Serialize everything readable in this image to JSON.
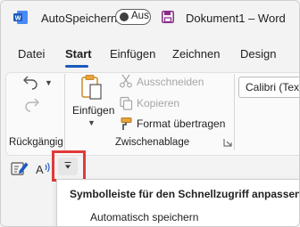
{
  "titlebar": {
    "autosave_label": "AutoSpeichern",
    "autosave_state": "Aus",
    "document_title": "Dokument1 – Word"
  },
  "tabs": [
    {
      "label": "Datei"
    },
    {
      "label": "Start"
    },
    {
      "label": "Einfügen"
    },
    {
      "label": "Zeichnen"
    },
    {
      "label": "Design"
    }
  ],
  "active_tab": "Start",
  "ribbon": {
    "undo_group_label": "Rückgängig",
    "paste_label": "Einfügen",
    "clipboard_group_label": "Zwischenablage",
    "cut_label": "Ausschneiden",
    "copy_label": "Kopieren",
    "format_painter_label": "Format übertragen",
    "font_name": "Calibri (Text)"
  },
  "menu": {
    "header": "Symbolleiste für den Schnellzugriff anpassen",
    "items": [
      {
        "label": "Automatisch speichern"
      }
    ]
  },
  "colors": {
    "accent": "#185abd",
    "word_blue": "#1e5bbd",
    "save_icon": "#8a2c8c",
    "highlight": "#e13a3a"
  },
  "icons": [
    "word-logo-icon",
    "save-icon",
    "undo-icon",
    "redo-icon",
    "paste-icon",
    "cut-icon",
    "copy-icon",
    "format-painter-icon",
    "dialog-launcher-icon",
    "edit-icon",
    "read-aloud-icon",
    "customize-qat-icon"
  ]
}
